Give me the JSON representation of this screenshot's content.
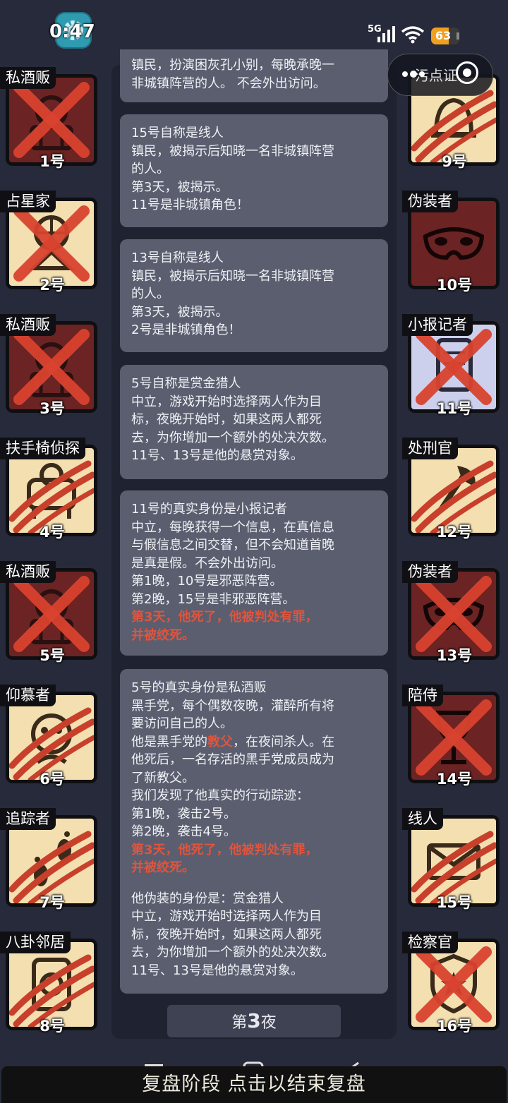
{
  "status_bar": {
    "time": "0:47",
    "network": "5G",
    "battery": "63",
    "battery_level": 0.63,
    "app_icon": "gear-icon"
  },
  "top_right": {
    "label": "污点证",
    "more_icon": "more-dots-icon",
    "target_icon": "target-icon"
  },
  "players": [
    {
      "num": "1号",
      "role": "私酒贩",
      "bg": "dark",
      "mark": "x",
      "icon": "smuggler-icon"
    },
    {
      "num": "2号",
      "role": "占星家",
      "bg": "tan",
      "mark": "x",
      "icon": "astrologer-icon"
    },
    {
      "num": "3号",
      "role": "私酒贩",
      "bg": "dark",
      "mark": "x",
      "icon": "smuggler-icon"
    },
    {
      "num": "4号",
      "role": "扶手椅侦探",
      "bg": "tan",
      "mark": "claw",
      "icon": "armchair-icon"
    },
    {
      "num": "5号",
      "role": "私酒贩",
      "bg": "dark",
      "mark": "x",
      "icon": "smuggler-icon"
    },
    {
      "num": "6号",
      "role": "仰慕者",
      "bg": "tan",
      "mark": "claw",
      "icon": "admirer-icon"
    },
    {
      "num": "7号",
      "role": "追踪者",
      "bg": "tan",
      "mark": "claw",
      "icon": "footprints-icon"
    },
    {
      "num": "8号",
      "role": "八卦邻居",
      "bg": "tan",
      "mark": "claw",
      "icon": "gossip-icon"
    },
    {
      "num": "9号",
      "role": "",
      "bg": "tan",
      "mark": "claw",
      "icon": "bell-icon"
    },
    {
      "num": "10号",
      "role": "伪装者",
      "bg": "dark",
      "mark": "none",
      "icon": "mask-icon"
    },
    {
      "num": "11号",
      "role": "小报记者",
      "bg": "lav",
      "mark": "x",
      "icon": "scroll-icon"
    },
    {
      "num": "12号",
      "role": "处刑官",
      "bg": "tan",
      "mark": "claw",
      "icon": "executioner-icon"
    },
    {
      "num": "13号",
      "role": "伪装者",
      "bg": "dark",
      "mark": "x",
      "icon": "mask-icon"
    },
    {
      "num": "14号",
      "role": "陪侍",
      "bg": "dark",
      "mark": "x",
      "icon": "glass-icon"
    },
    {
      "num": "15号",
      "role": "线人",
      "bg": "tan",
      "mark": "claw",
      "icon": "envelope-icon"
    },
    {
      "num": "16号",
      "role": "检察官",
      "bg": "tan",
      "mark": "x",
      "icon": "badge-icon"
    }
  ],
  "messages": [
    {
      "lines": [
        {
          "t": "镇民，扮演困灰孔小别，每晚承晚一",
          "c": ""
        },
        {
          "t": "非城镇阵营的人。 不会外出访问。",
          "c": ""
        }
      ]
    },
    {
      "lines": [
        {
          "t": "15号自称是线人",
          "c": ""
        },
        {
          "t": "镇民，被揭示后知晓一名非城镇阵营",
          "c": ""
        },
        {
          "t": "的人。",
          "c": ""
        },
        {
          "t": "第3天，被揭示。",
          "c": ""
        },
        {
          "t": "11号是非城镇角色！",
          "c": ""
        }
      ]
    },
    {
      "lines": [
        {
          "t": "13号自称是线人",
          "c": ""
        },
        {
          "t": "镇民，被揭示后知晓一名非城镇阵营",
          "c": ""
        },
        {
          "t": "的人。",
          "c": ""
        },
        {
          "t": "第3天，被揭示。",
          "c": ""
        },
        {
          "t": "2号是非城镇角色！",
          "c": ""
        }
      ]
    },
    {
      "lines": [
        {
          "t": "5号自称是赏金猎人",
          "c": ""
        },
        {
          "t": "中立，游戏开始时选择两人作为目",
          "c": ""
        },
        {
          "t": "标，夜晚开始时，如果这两人都死",
          "c": ""
        },
        {
          "t": "去，为你增加一个额外的处决次数。",
          "c": ""
        },
        {
          "t": "11号、13号是他的悬赏对象。",
          "c": ""
        }
      ]
    },
    {
      "lines": [
        {
          "t": "11号的真实身份是小报记者",
          "c": ""
        },
        {
          "t": "中立，每晚获得一个信息，在真信息",
          "c": ""
        },
        {
          "t": "与假信息之间交替，但不会知道首晚",
          "c": ""
        },
        {
          "t": "是真是假。不会外出访问。",
          "c": ""
        },
        {
          "t": "第1晚，10号是邪恶阵营。",
          "c": ""
        },
        {
          "t": "第2晚，15号是非邪恶阵营。",
          "c": ""
        },
        {
          "t": "第3天，他死了，他被判处有罪，",
          "c": "red"
        },
        {
          "t": "并被绞死。",
          "c": "red"
        }
      ]
    },
    {
      "lines": [
        {
          "t": "5号的真实身份是私酒贩",
          "c": ""
        },
        {
          "t": "黑手党，每个偶数夜晚，灌醉所有将",
          "c": ""
        },
        {
          "t": "要访问自己的人。",
          "c": ""
        },
        {
          "t": "他是黑手党的教父，在夜间杀人。在",
          "c": "mix"
        },
        {
          "t": "他死后，一名存活的黑手党成员成为",
          "c": ""
        },
        {
          "t": "了新教父。",
          "c": ""
        },
        {
          "t": "我们发现了他真实的行动踪迹：",
          "c": ""
        },
        {
          "t": "第1晚，袭击2号。",
          "c": ""
        },
        {
          "t": "第2晚，袭击4号。",
          "c": ""
        },
        {
          "t": "第3天，他死了，他被判处有罪，",
          "c": "red"
        },
        {
          "t": "并被绞死。",
          "c": "red"
        },
        {
          "t": "",
          "c": "gap"
        },
        {
          "t": "他伪装的身份是：赏金猎人",
          "c": ""
        },
        {
          "t": "中立，游戏开始时选择两人作为目",
          "c": ""
        },
        {
          "t": "标，夜晚开始时，如果这两人都死",
          "c": ""
        },
        {
          "t": "去，为你增加一个额外的处决次数。",
          "c": ""
        },
        {
          "t": "11号、13号是他的悬赏对象。",
          "c": ""
        }
      ]
    }
  ],
  "highlight_word": "教父",
  "night": {
    "prefix": "第",
    "num": "3",
    "suffix": "夜"
  },
  "bottom_bar": "复盘阶段 点击以结束复盘",
  "colors": {
    "red": "#e0543d",
    "tan": "#f3dfb0",
    "dark": "#6b2323",
    "lav": "#ccd0ec"
  }
}
